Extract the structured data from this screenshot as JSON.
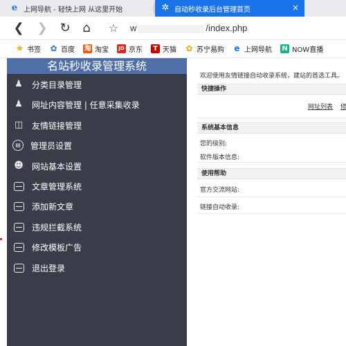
{
  "browser": {
    "tabs": [
      {
        "label": "上网导航 - 轻快上网 从这里开始",
        "icon": "ie-icon",
        "active": false
      },
      {
        "label": "自动秒收录后台管理首页",
        "icon": "ie-icon",
        "active": true
      }
    ],
    "tab_close": "×",
    "address": {
      "prefix": "w",
      "suffix": "/index.php"
    },
    "bookmarks": [
      {
        "label": "书签",
        "icon": "star-icon",
        "glyph": "★"
      },
      {
        "label": "百度",
        "icon": "baidu-paw-icon",
        "glyph": "✿"
      },
      {
        "label": "淘宝",
        "icon": "taobao-icon",
        "glyph": "淘"
      },
      {
        "label": "京东",
        "icon": "jd-icon",
        "glyph": "JD"
      },
      {
        "label": "天猫",
        "icon": "tmall-icon",
        "glyph": "T"
      },
      {
        "label": "苏宁易购",
        "icon": "suning-icon",
        "glyph": "✿"
      },
      {
        "label": "上网导航",
        "icon": "ie-icon",
        "glyph": "e"
      },
      {
        "label": "NOW直播",
        "icon": "now-live-icon",
        "glyph": "N"
      }
    ]
  },
  "sidebar": {
    "title": "名站秒收录管理系统",
    "items": [
      {
        "label": "分类目录管理",
        "icon": "users-icon"
      },
      {
        "label": "网址内容管理 | 任意采集收录",
        "icon": "users-icon"
      },
      {
        "label": "友情链接管理",
        "icon": "shop-icon"
      },
      {
        "label": "管理员设置",
        "icon": "admin-icon"
      },
      {
        "label": "网站基本设置",
        "icon": "user-settings-icon"
      },
      {
        "label": "文章管理系统",
        "icon": "store-icon"
      },
      {
        "label": "添加新文章",
        "icon": "store-icon"
      },
      {
        "label": "违规拦截系统",
        "icon": "store-icon"
      },
      {
        "label": "修改模板广告",
        "icon": "store-icon"
      },
      {
        "label": "退出登录",
        "icon": "store-icon"
      }
    ]
  },
  "main": {
    "welcome": "欢迎使用友情链接自动收录系统，建站的首选工具。",
    "quick_ops": {
      "heading": "快捷操作",
      "links": [
        "网址列表",
        "修"
      ]
    },
    "sys_info": {
      "heading": "系统基本信息",
      "level_label": "您的级别:",
      "version_label": "软件版本信息:"
    },
    "help": {
      "heading": "使用帮助",
      "official_label": "官方交流网站:",
      "auto_label": "链接自动收录:"
    }
  },
  "colors": {
    "sidebar_bg": "#393d49",
    "sidebar_title_bg": "#4f6fa8",
    "active_tab": "#1a73e8"
  }
}
